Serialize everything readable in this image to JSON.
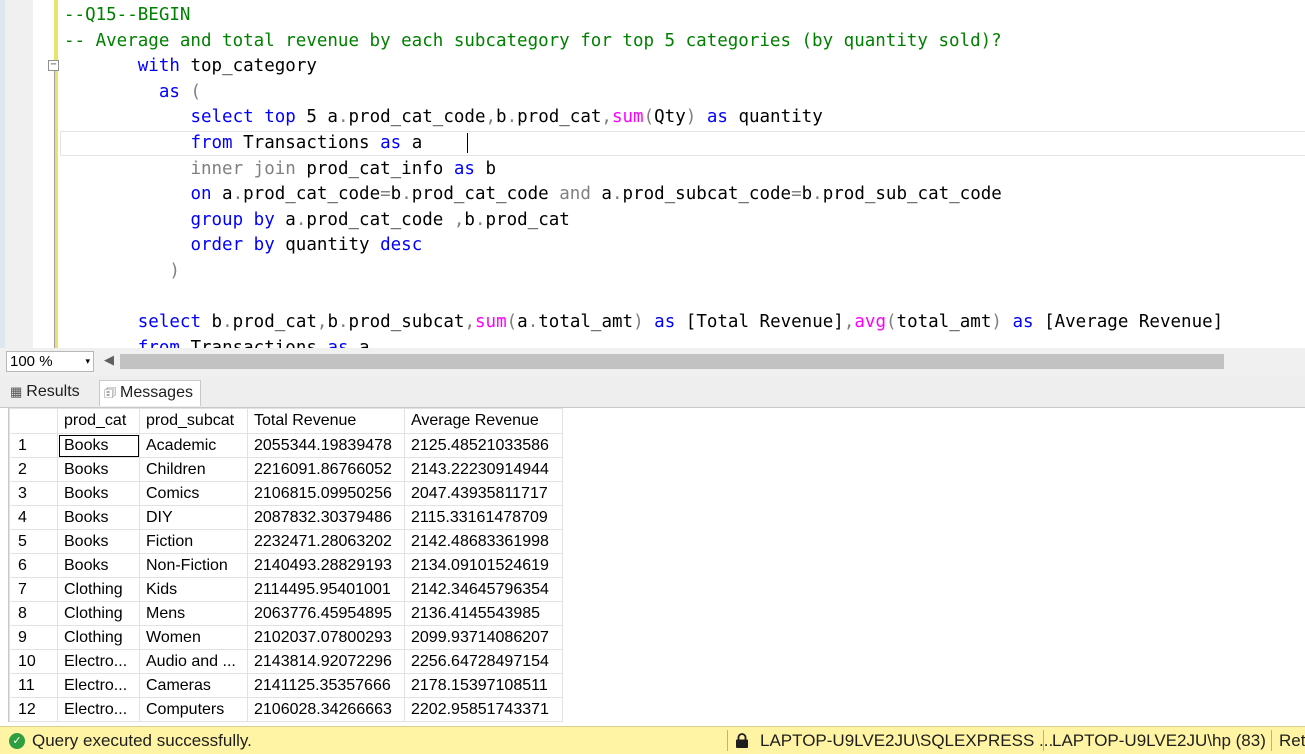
{
  "editor": {
    "lines": [
      [
        {
          "t": "--Q15--BEGIN",
          "c": "cm"
        }
      ],
      [
        {
          "t": "-- Average and total revenue by each subcategory for top 5 categories (by quantity sold)?",
          "c": "cm"
        }
      ],
      [
        {
          "t": "       "
        },
        {
          "t": "with",
          "c": "kw"
        },
        {
          "t": " top_category"
        }
      ],
      [
        {
          "t": "         "
        },
        {
          "t": "as",
          "c": "kw"
        },
        {
          "t": " "
        },
        {
          "t": "(",
          "c": "op"
        }
      ],
      [
        {
          "t": "            "
        },
        {
          "t": "select",
          "c": "kw"
        },
        {
          "t": " "
        },
        {
          "t": "top",
          "c": "kw"
        },
        {
          "t": " 5 a"
        },
        {
          "t": ".",
          "c": "op"
        },
        {
          "t": "prod_cat_code"
        },
        {
          "t": ",",
          "c": "op"
        },
        {
          "t": "b"
        },
        {
          "t": ".",
          "c": "op"
        },
        {
          "t": "prod_cat"
        },
        {
          "t": ",",
          "c": "op"
        },
        {
          "t": "sum",
          "c": "fn"
        },
        {
          "t": "(",
          "c": "op"
        },
        {
          "t": "Qty"
        },
        {
          "t": ")",
          "c": "op"
        },
        {
          "t": " "
        },
        {
          "t": "as",
          "c": "kw"
        },
        {
          "t": " quantity"
        }
      ],
      [
        {
          "t": "            "
        },
        {
          "t": "from",
          "c": "kw"
        },
        {
          "t": " Transactions "
        },
        {
          "t": "as",
          "c": "kw"
        },
        {
          "t": " a"
        }
      ],
      [
        {
          "t": "            "
        },
        {
          "t": "inner join",
          "c": "op"
        },
        {
          "t": " prod_cat_info "
        },
        {
          "t": "as",
          "c": "kw"
        },
        {
          "t": " b"
        }
      ],
      [
        {
          "t": "            "
        },
        {
          "t": "on",
          "c": "kw"
        },
        {
          "t": " a"
        },
        {
          "t": ".",
          "c": "op"
        },
        {
          "t": "prod_cat_code"
        },
        {
          "t": "=",
          "c": "op"
        },
        {
          "t": "b"
        },
        {
          "t": ".",
          "c": "op"
        },
        {
          "t": "prod_cat_code "
        },
        {
          "t": "and",
          "c": "op"
        },
        {
          "t": " a"
        },
        {
          "t": ".",
          "c": "op"
        },
        {
          "t": "prod_subcat_code"
        },
        {
          "t": "=",
          "c": "op"
        },
        {
          "t": "b"
        },
        {
          "t": ".",
          "c": "op"
        },
        {
          "t": "prod_sub_cat_code"
        }
      ],
      [
        {
          "t": "            "
        },
        {
          "t": "group by",
          "c": "kw"
        },
        {
          "t": " a"
        },
        {
          "t": ".",
          "c": "op"
        },
        {
          "t": "prod_cat_code "
        },
        {
          "t": ",",
          "c": "op"
        },
        {
          "t": "b"
        },
        {
          "t": ".",
          "c": "op"
        },
        {
          "t": "prod_cat"
        }
      ],
      [
        {
          "t": "            "
        },
        {
          "t": "order by",
          "c": "kw"
        },
        {
          "t": " quantity "
        },
        {
          "t": "desc",
          "c": "kw"
        }
      ],
      [
        {
          "t": "          "
        },
        {
          "t": ")",
          "c": "op"
        }
      ],
      [
        {
          "t": ""
        }
      ],
      [
        {
          "t": "       "
        },
        {
          "t": "select",
          "c": "kw"
        },
        {
          "t": " b"
        },
        {
          "t": ".",
          "c": "op"
        },
        {
          "t": "prod_cat"
        },
        {
          "t": ",",
          "c": "op"
        },
        {
          "t": "b"
        },
        {
          "t": ".",
          "c": "op"
        },
        {
          "t": "prod_subcat"
        },
        {
          "t": ",",
          "c": "op"
        },
        {
          "t": "sum",
          "c": "fn"
        },
        {
          "t": "(",
          "c": "op"
        },
        {
          "t": "a"
        },
        {
          "t": ".",
          "c": "op"
        },
        {
          "t": "total_amt"
        },
        {
          "t": ")",
          "c": "op"
        },
        {
          "t": " "
        },
        {
          "t": "as",
          "c": "kw"
        },
        {
          "t": " [Total Revenue]"
        },
        {
          "t": ",",
          "c": "op"
        },
        {
          "t": "avg",
          "c": "fn"
        },
        {
          "t": "(",
          "c": "op"
        },
        {
          "t": "total_amt"
        },
        {
          "t": ")",
          "c": "op"
        },
        {
          "t": " "
        },
        {
          "t": "as",
          "c": "kw"
        },
        {
          "t": " [Average Revenue]"
        }
      ],
      [
        {
          "t": "       "
        },
        {
          "t": "from",
          "c": "kw"
        },
        {
          "t": " Transactions "
        },
        {
          "t": "as",
          "c": "kw"
        },
        {
          "t": " a"
        }
      ]
    ],
    "fold_icon": "minus-box-icon"
  },
  "zoom": {
    "value": "100 %",
    "arrow": "▾",
    "scroll_left": "◀"
  },
  "tabs": {
    "results_label": "Results",
    "messages_label": "Messages",
    "results_icon": "▦",
    "messages_icon": "🗊"
  },
  "grid": {
    "columns": [
      "",
      "prod_cat",
      "prod_subcat",
      "Total Revenue",
      "Average Revenue"
    ],
    "col_widths": [
      48,
      82,
      108,
      157,
      158
    ],
    "rows": [
      [
        "1",
        "Books",
        "Academic",
        "2055344.19839478",
        "2125.48521033586"
      ],
      [
        "2",
        "Books",
        "Children",
        "2216091.86766052",
        "2143.22230914944"
      ],
      [
        "3",
        "Books",
        "Comics",
        "2106815.09950256",
        "2047.43935811717"
      ],
      [
        "4",
        "Books",
        "DIY",
        "2087832.30379486",
        "2115.33161478709"
      ],
      [
        "5",
        "Books",
        "Fiction",
        "2232471.28063202",
        "2142.48683361998"
      ],
      [
        "6",
        "Books",
        "Non-Fiction",
        "2140493.28829193",
        "2134.09101524619"
      ],
      [
        "7",
        "Clothing",
        "Kids",
        "2114495.95401001",
        "2142.34645796354"
      ],
      [
        "8",
        "Clothing",
        "Mens",
        "2063776.45954895",
        "2136.4145543985"
      ],
      [
        "9",
        "Clothing",
        "Women",
        "2102037.07800293",
        "2099.93714086207"
      ],
      [
        "10",
        "Electro...",
        "Audio and ...",
        "2143814.92072296",
        "2256.64728497154"
      ],
      [
        "11",
        "Electro...",
        "Cameras",
        "2141125.35357666",
        "2178.15397108511"
      ],
      [
        "12",
        "Electro...",
        "Computers",
        "2106028.34266663",
        "2202.95851743371"
      ]
    ]
  },
  "status": {
    "message": "Query executed successfully.",
    "check": "✓",
    "server": "LAPTOP-U9LVE2JU\\SQLEXPRESS ...",
    "user": "LAPTOP-U9LVE2JU\\hp (83)",
    "extra": "Ret",
    "status_color": "#fff4a3"
  }
}
